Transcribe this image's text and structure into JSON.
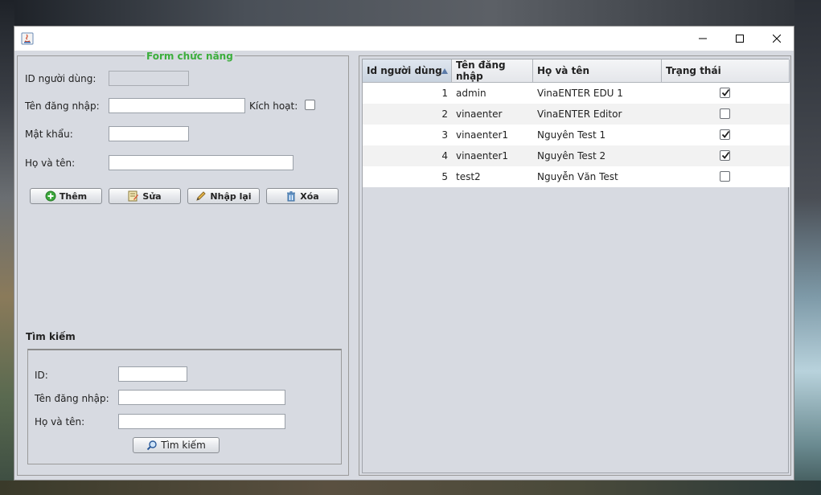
{
  "window": {
    "title": "",
    "controls": {
      "minimize": "—",
      "maximize": "☐",
      "close": "✕"
    }
  },
  "form": {
    "legend": "Form chức năng",
    "id_label": "ID người dùng:",
    "username_label": "Tên đăng nhập:",
    "active_label": "Kích hoạt:",
    "password_label": "Mật khẩu:",
    "fullname_label": "Họ và tên:",
    "id_value": "",
    "username_value": "",
    "password_value": "",
    "fullname_value": "",
    "active_checked": false,
    "buttons": {
      "add": "Thêm",
      "edit": "Sửa",
      "reset": "Nhập lại",
      "delete": "Xóa"
    }
  },
  "search": {
    "title": "Tìm kiếm",
    "id_label": "ID:",
    "username_label": "Tên đăng nhập:",
    "fullname_label": "Họ và tên:",
    "id_value": "",
    "username_value": "",
    "fullname_value": "",
    "button": "Tìm kiếm"
  },
  "table": {
    "columns": [
      "Id người dùng",
      "Tên đăng nhập",
      "Họ và tên",
      "Trạng thái"
    ],
    "sorted_column": 0,
    "rows": [
      {
        "id": "1",
        "username": "admin",
        "fullname": "VinaENTER EDU 1",
        "active": true
      },
      {
        "id": "2",
        "username": "vinaenter",
        "fullname": "VinaENTER Editor",
        "active": false
      },
      {
        "id": "3",
        "username": "vinaenter1",
        "fullname": "Nguyên Test 1",
        "active": true
      },
      {
        "id": "4",
        "username": "vinaenter1",
        "fullname": "Nguyên Test 2",
        "active": true
      },
      {
        "id": "5",
        "username": "test2",
        "fullname": "Nguyễn Văn Test",
        "active": false
      }
    ]
  },
  "colors": {
    "legend_green": "#3cae3c",
    "panel_bg": "#d7dae1",
    "sort_arrow": "#5a7aa8"
  }
}
